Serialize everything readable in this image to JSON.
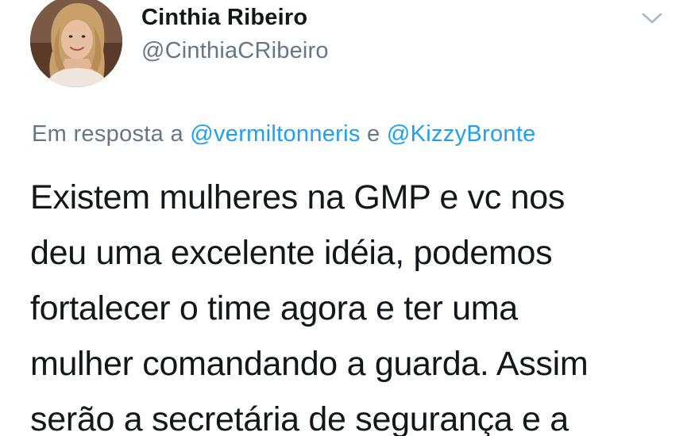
{
  "user": {
    "display_name": "Cinthia Ribeiro",
    "handle": "@CinthiaCRibeiro",
    "avatar_icon": "profile-photo-avatar"
  },
  "menu": {
    "icon": "chevron-down-icon"
  },
  "reply": {
    "prefix": "Em resposta a",
    "mention_1": "@vermiltonneris",
    "connector": "e",
    "mention_2": "@KizzyBronte"
  },
  "tweet": {
    "lines": [
      "Existem mulheres na GMP e vc nos",
      "deu uma excelente idéia, podemos",
      "fortalecer o time agora e ter uma",
      "mulher comandando a guarda. Assim",
      "serão a secretária de segurança e a"
    ]
  },
  "colors": {
    "text": "#14171a",
    "secondary": "#657786",
    "link": "#1da1f2"
  }
}
